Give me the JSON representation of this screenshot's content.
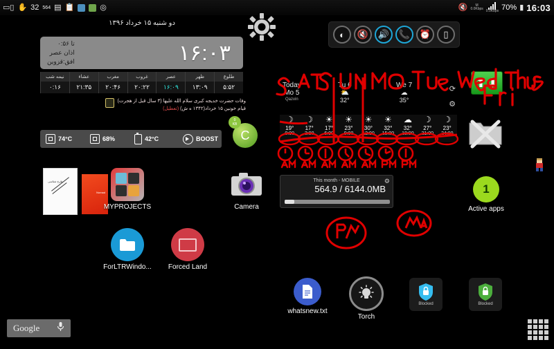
{
  "statusbar": {
    "left_icons": [
      "sim-icon",
      "hand-icon",
      "temperature-icon",
      "data-icon",
      "calendar-icon",
      "clipboard-icon",
      "shield-blue-icon",
      "shield-green-icon",
      "compass-icon"
    ],
    "cpu_temp": "32",
    "data_value": "564",
    "right": {
      "mute-icon": "mute-icon",
      "signal_label": "M",
      "uplink_speed": "0.0Kbps",
      "downlink_speed": "0.0Kbps",
      "battery_percent": "70%",
      "clock": "16:03"
    }
  },
  "persian_widget": {
    "date_line": "دو شنبه ۱۵ خرداد ۱۳۹۶",
    "card": {
      "line1": "تا ۰:۵۶",
      "line2": "اذان عصر",
      "line3": "افق:قزوین",
      "clock": "۱۶:۰۳"
    },
    "table": {
      "headers": [
        "نیمه شب",
        "عشاء",
        "مغرب",
        "غروب",
        "عصر",
        "ظهر",
        "طلوع"
      ],
      "values": [
        "۰:۱۶",
        "۲۱:۳۵",
        "۲۰:۴۶",
        "۲۰:۲۲",
        "۱۶:۰۹",
        "۱۳:۰۹",
        "۵:۵۲"
      ],
      "highlight_index": 4
    },
    "note_line1": "وفات حضرت خدیجه کبری سلام الله علیها (۳ سال قبل از هجرت)",
    "note_line2": "قیام خونین ۱۵ خرداد(۱۳۴۲ ه ش)",
    "note_badge": "(تعطیل)"
  },
  "perfbar": {
    "cpu_temp": "74°C",
    "ram_usage": "68%",
    "battery_temp": "42°C",
    "boost_label": "BOOST"
  },
  "toggles": [
    {
      "name": "brightness-toggle",
      "glyph": "◐",
      "active": false
    },
    {
      "name": "mute-toggle",
      "glyph": "🔇",
      "active": false
    },
    {
      "name": "volume-toggle",
      "glyph": "🔊",
      "active": true
    },
    {
      "name": "call-toggle",
      "glyph": "📞",
      "active": true
    },
    {
      "name": "alarm-toggle",
      "glyph": "⏰",
      "active": false
    },
    {
      "name": "rotation-toggle",
      "glyph": "▯",
      "active": false
    }
  ],
  "weather": {
    "days": [
      {
        "label1": "Today",
        "label2": "Mo 5",
        "city": "Qazvin",
        "temp": "",
        "icon": ""
      },
      {
        "label1": "",
        "label2": "Tu 6",
        "city": "",
        "temp": "32°",
        "icon": "partly-sunny-icon"
      },
      {
        "label1": "",
        "label2": "We 7",
        "city": "",
        "temp": "35°",
        "icon": "cloud-icon"
      }
    ],
    "refresh_icon": "refresh-icon",
    "settings_icon": "gear-icon",
    "hours": [
      {
        "time": "0:00",
        "temp": "19°",
        "icon": "moon-icon"
      },
      {
        "time": "3:00",
        "temp": "17°",
        "icon": "moon-icon"
      },
      {
        "time": "6:00",
        "temp": "17°",
        "icon": "sun-cloud-icon"
      },
      {
        "time": "9:00",
        "temp": "23°",
        "icon": "sun-icon"
      },
      {
        "time": "12:00",
        "temp": "30°",
        "icon": "sun-icon"
      },
      {
        "time": "15:00",
        "temp": "32°",
        "icon": "sun-cloud-icon"
      },
      {
        "time": "18:00",
        "temp": "32°",
        "icon": "cloud-icon"
      },
      {
        "time": "21:00",
        "temp": "27°",
        "icon": "moon-icon"
      },
      {
        "time": "24:00",
        "temp": "23°",
        "icon": "moon-icon"
      }
    ]
  },
  "data_usage": {
    "title": "This month - MOBILE",
    "value": "564.9 / 6144.0MB",
    "progress_percent": 9
  },
  "apps": {
    "book_white": {
      "name": "book-white-icon",
      "label": ""
    },
    "book_red": {
      "name": "book-red-icon",
      "label": ""
    },
    "myprojects": {
      "label": "MYPROJECTS"
    },
    "camera": {
      "label": "Camera"
    },
    "forltr": {
      "label": "ForLTRWindo..."
    },
    "forced_land": {
      "label": "Forced Land"
    },
    "whatsnew": {
      "label": "whatsnew.txt"
    },
    "torch": {
      "label": "Torch"
    },
    "blocked_blue": {
      "label": "Blocked"
    },
    "blocked_green": {
      "label": "Blocked"
    }
  },
  "right_panel": {
    "updown_icon": "up-down-arrows-icon",
    "folder_x_icon": "folder-cancel-icon",
    "mario_icon": "mario-sprite-icon",
    "active_apps": {
      "count": "1",
      "label": "Active apps"
    }
  },
  "dock": {
    "google_label": "Google",
    "mic_icon": "microphone-icon",
    "apps_grid_icon": "apps-grid-icon"
  },
  "annotations": {
    "color": "#e00000",
    "day_words": [
      "SAT",
      "SUN",
      "MO",
      "Tue",
      "Wed",
      "Thus",
      "Fri"
    ],
    "ampm": [
      "AM",
      "AM",
      "AM",
      "AM",
      "AM",
      "PM",
      "PM"
    ],
    "bottom_marks": [
      "PM",
      "AM"
    ]
  },
  "colors": {
    "background": "#000000",
    "accent_blue": "#1ea7d8",
    "accent_green": "#9bd91e",
    "ink_red": "#e00000",
    "card_gray": "#8a8a8a"
  }
}
